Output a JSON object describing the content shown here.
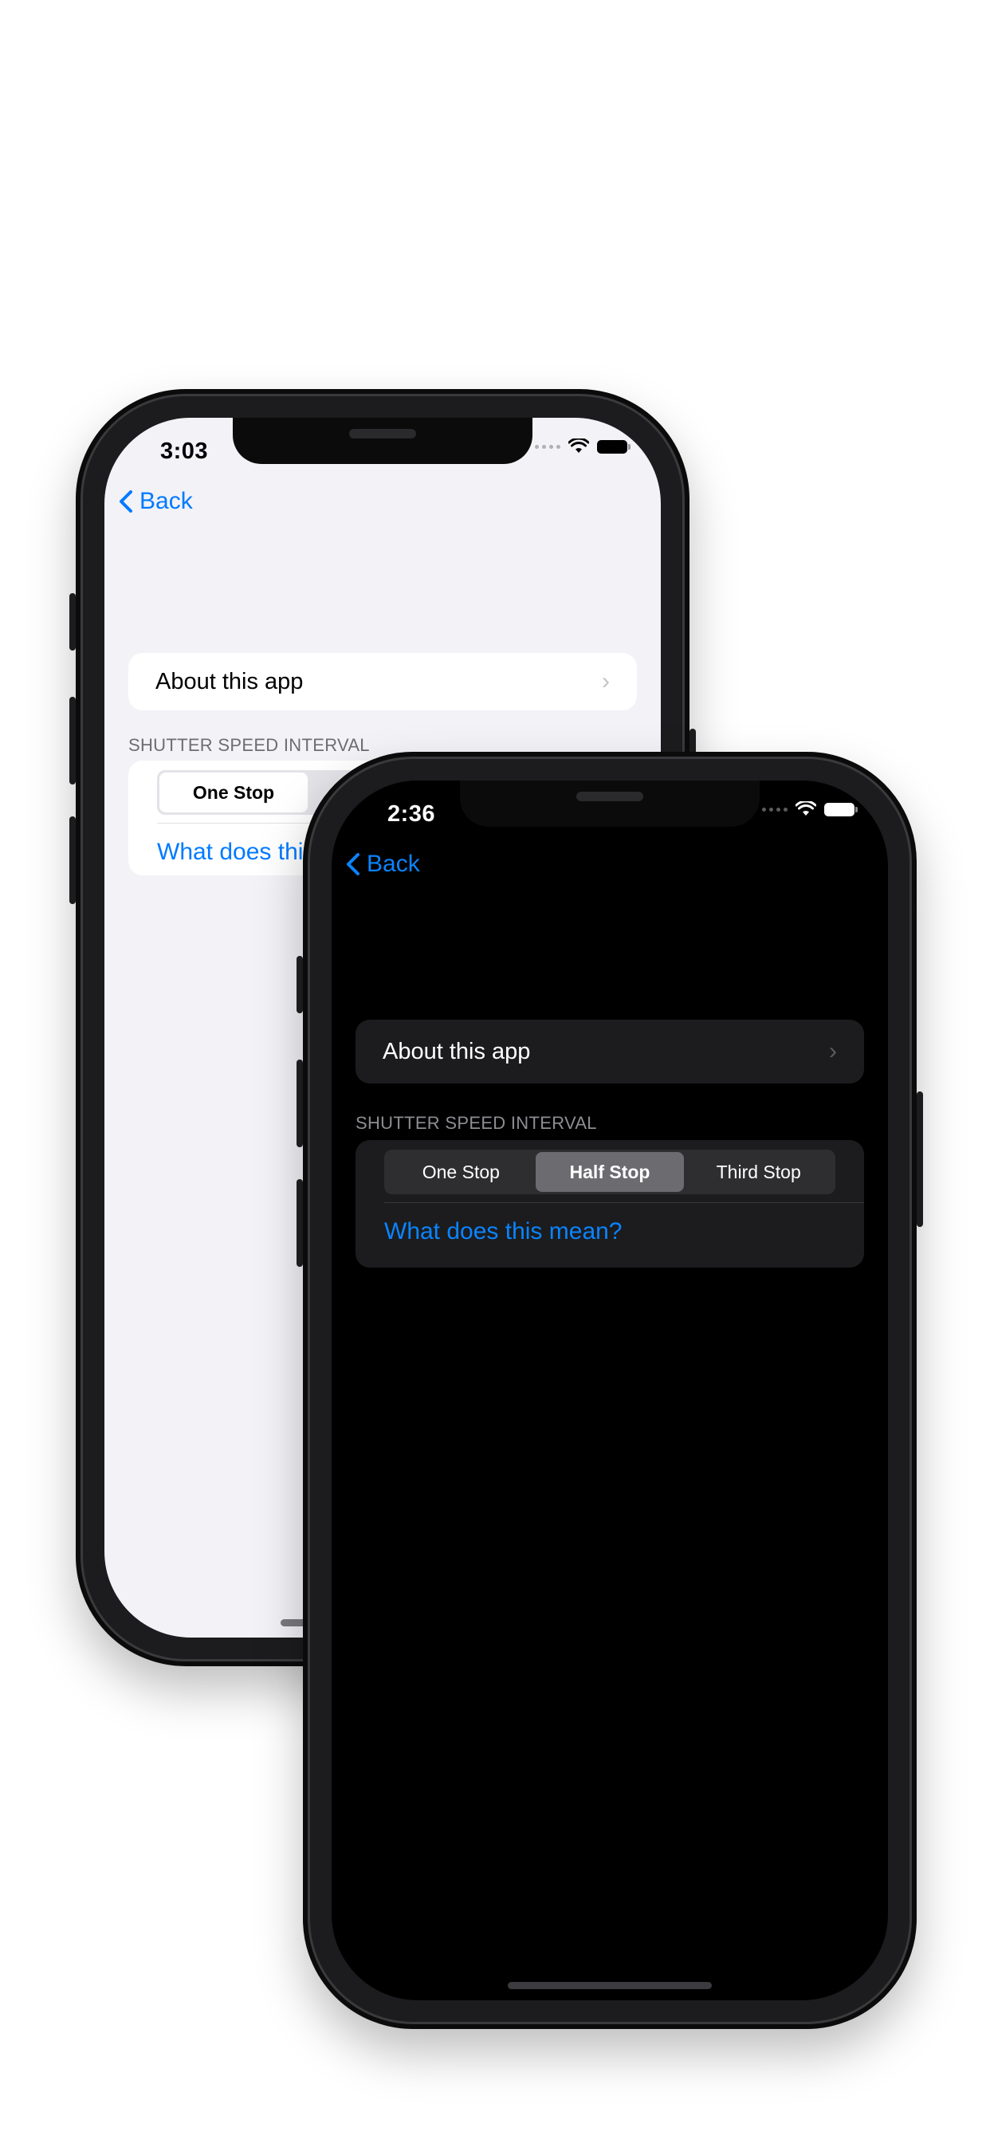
{
  "light_phone": {
    "time": "3:03",
    "back_label": "Back",
    "about_label": "About this app",
    "section_header": "SHUTTER SPEED INTERVAL",
    "segments": [
      "One Stop"
    ],
    "link_label": "What does this"
  },
  "dark_phone": {
    "time": "2:36",
    "back_label": "Back",
    "about_label": "About this app",
    "section_header": "SHUTTER SPEED INTERVAL",
    "segments": [
      "One Stop",
      "Half Stop",
      "Third Stop"
    ],
    "selected_segment": "Half Stop",
    "link_label": "What does this mean?"
  },
  "colors": {
    "accent_light": "#007aff",
    "accent_dark": "#0a84ff",
    "light_background": "#f2f2f7",
    "dark_background": "#000000"
  },
  "icons": {
    "back": "chevron-left-icon",
    "row_disclosure": "chevron-right-icon",
    "wifi": "wifi-icon",
    "battery": "battery-icon",
    "signal": "cellular-dots-icon"
  }
}
